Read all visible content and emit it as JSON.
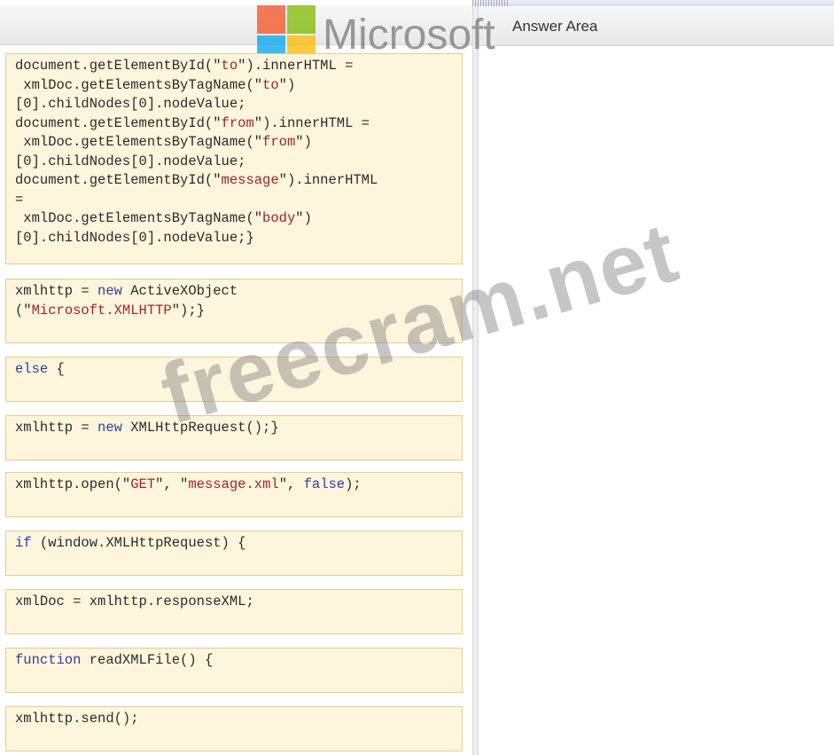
{
  "window": {
    "answer_area_title": "Answer Area"
  },
  "logo": {
    "text": "Microsoft",
    "colors": [
      "#f25022",
      "#7fba00",
      "#00a4ef",
      "#ffb900"
    ]
  },
  "watermark": {
    "text": "freecram.net"
  },
  "tiles": [
    {
      "lines": [
        [
          [
            "t",
            "document.getElementById(\""
          ],
          [
            "s",
            "to"
          ],
          [
            "t",
            "\").innerHTML ="
          ]
        ],
        [
          [
            "t",
            " xmlDoc.getElementsByTagName(\""
          ],
          [
            "s",
            "to"
          ],
          [
            "t",
            "\")"
          ]
        ],
        [
          [
            "t",
            "[0].childNodes[0].nodeValue;"
          ]
        ],
        [
          [
            "t",
            "document.getElementById(\""
          ],
          [
            "s",
            "from"
          ],
          [
            "t",
            "\").innerHTML ="
          ]
        ],
        [
          [
            "t",
            " xmlDoc.getElementsByTagName(\""
          ],
          [
            "s",
            "from"
          ],
          [
            "t",
            "\")"
          ]
        ],
        [
          [
            "t",
            "[0].childNodes[0].nodeValue;"
          ]
        ],
        [
          [
            "t",
            "document.getElementById(\""
          ],
          [
            "s",
            "message"
          ],
          [
            "t",
            "\").innerHTML"
          ]
        ],
        [
          [
            "t",
            "="
          ]
        ],
        [
          [
            "t",
            " xmlDoc.getElementsByTagName(\""
          ],
          [
            "s",
            "body"
          ],
          [
            "t",
            "\")"
          ]
        ],
        [
          [
            "t",
            "[0].childNodes[0].nodeValue;}"
          ]
        ]
      ]
    },
    {
      "lines": [
        [
          [
            "t",
            "xmlhttp = "
          ],
          [
            "k",
            "new"
          ],
          [
            "t",
            " ActiveXObject"
          ]
        ],
        [
          [
            "t",
            "(\""
          ],
          [
            "s",
            "Microsoft.XMLHTTP"
          ],
          [
            "t",
            "\");}"
          ]
        ]
      ]
    },
    {
      "lines": [
        [
          [
            "k",
            "else"
          ],
          [
            "t",
            " {"
          ]
        ]
      ]
    },
    {
      "lines": [
        [
          [
            "t",
            "xmlhttp = "
          ],
          [
            "k",
            "new"
          ],
          [
            "t",
            " XMLHttpRequest();}"
          ]
        ]
      ]
    },
    {
      "lines": [
        [
          [
            "t",
            "xmlhttp.open(\""
          ],
          [
            "s",
            "GET"
          ],
          [
            "t",
            "\", \""
          ],
          [
            "s",
            "message.xml"
          ],
          [
            "t",
            "\", "
          ],
          [
            "k",
            "false"
          ],
          [
            "t",
            ");"
          ]
        ]
      ]
    },
    {
      "lines": [
        [
          [
            "k",
            "if"
          ],
          [
            "t",
            " (window.XMLHttpRequest) {"
          ]
        ]
      ]
    },
    {
      "lines": [
        [
          [
            "t",
            "xmlDoc = xmlhttp.responseXML;"
          ]
        ]
      ]
    },
    {
      "lines": [
        [
          [
            "k",
            "function"
          ],
          [
            "t",
            " readXMLFile() {"
          ]
        ]
      ]
    },
    {
      "lines": [
        [
          [
            "t",
            "xmlhttp.send();"
          ]
        ]
      ]
    }
  ]
}
